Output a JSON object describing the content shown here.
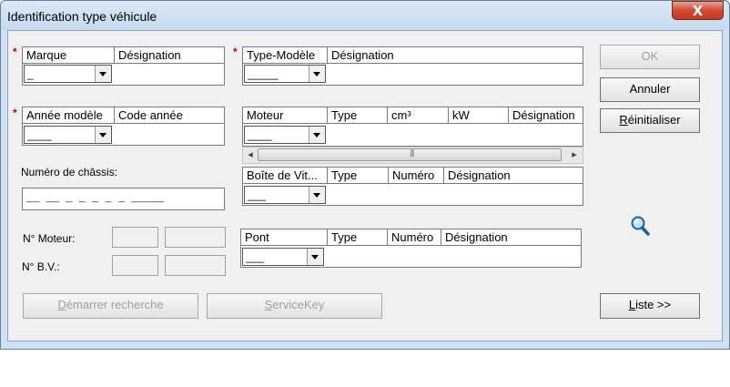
{
  "window": {
    "title": "Identification type véhicule",
    "close_glyph": "X"
  },
  "marque": {
    "col_marque": "Marque",
    "col_designation": "Désignation",
    "combo_value": "_"
  },
  "type_modele": {
    "col_type_modele": "Type-Modèle",
    "col_designation": "Désignation",
    "combo_value": "_____"
  },
  "annee": {
    "col_annee_modele": "Année modèle",
    "col_code_annee": "Code année",
    "combo_value": "____"
  },
  "moteur": {
    "col_moteur": "Moteur",
    "col_type": "Type",
    "col_cm3": "cm³",
    "col_kw": "kW",
    "col_designation": "Désignation",
    "combo_value": "____"
  },
  "boite": {
    "col_boite": "Boîte de Vit...",
    "col_type": "Type",
    "col_numero": "Numéro",
    "col_designation": "Désignation",
    "combo_value": "___"
  },
  "pont": {
    "col_pont": "Pont",
    "col_type": "Type",
    "col_numero": "Numéro",
    "col_designation": "Désignation",
    "combo_value": "___"
  },
  "chassis": {
    "label": "Numéro de châssis:",
    "mask": "__ __ _ _ _ _ _ _____"
  },
  "engine_fields": {
    "moteur_label": "N° Moteur:",
    "bv_label": "N° B.V.:"
  },
  "buttons": {
    "ok": "OK",
    "annuler": "Annuler",
    "reinitialiser_prefix": "R",
    "reinitialiser_rest": "éinitialiser",
    "demarrer_prefix": "D",
    "demarrer_rest": "émarrer recherche",
    "servicekey_prefix": "S",
    "servicekey_rest": "erviceKey",
    "liste_prefix": "L",
    "liste_rest": "iste >>"
  },
  "required_marker": "*",
  "scroll_thumb_grip": "⦀",
  "icons": {
    "search": "magnifier-icon",
    "scroll_left": "◂",
    "scroll_right": "▸"
  },
  "colors": {
    "title_bar": "#c5d9ef",
    "close_button": "#d0492f",
    "required": "#c00000",
    "disabled_text": "#a0a0a0"
  }
}
